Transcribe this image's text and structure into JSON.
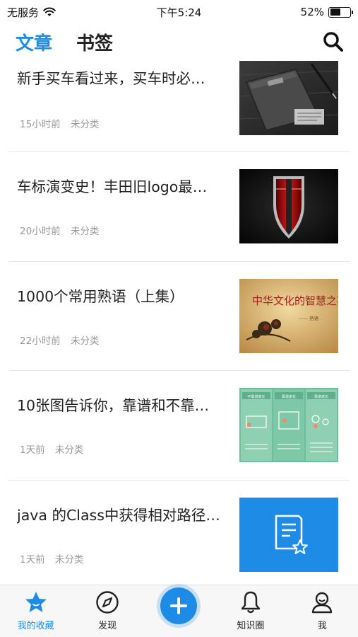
{
  "status_bar": {
    "carrier": "无服务",
    "time": "下午5:24",
    "battery_percent": "52%",
    "battery_level": 0.52
  },
  "header": {
    "tabs": [
      {
        "label": "文章",
        "active": true
      },
      {
        "label": "书签",
        "active": false
      }
    ],
    "search_icon": "search-icon"
  },
  "articles": [
    {
      "title": "新手买车看过来，买车时必…",
      "time": "15小时前",
      "category": "未分类",
      "thumb": "notebook-image"
    },
    {
      "title": "车标演变史！丰田旧logo最…",
      "time": "20小时前",
      "category": "未分类",
      "thumb": "car-logo-image"
    },
    {
      "title": "1000个常用熟语（上集）",
      "time": "22小时前",
      "category": "未分类",
      "thumb": "chinese-culture-image",
      "thumb_text": "中华文化的智慧之花",
      "thumb_sub": "—— 熟语"
    },
    {
      "title": "10张图告诉你，靠谱和不靠…",
      "time": "1天前",
      "category": "未分类",
      "thumb": "infographic-image",
      "thumb_cols": [
        "不靠谱家长",
        "靠谱家长",
        "靠谱家长"
      ]
    },
    {
      "title": "java 的Class中获得相对路径…",
      "time": "1天前",
      "category": "未分类",
      "thumb": "document-star-icon"
    }
  ],
  "bottom_nav": {
    "items": [
      {
        "label": "我的收藏",
        "icon": "star-icon",
        "active": true
      },
      {
        "label": "发现",
        "icon": "compass-icon",
        "active": false
      },
      {
        "label": "",
        "icon": "plus-icon",
        "active": false
      },
      {
        "label": "知识圈",
        "icon": "bell-icon",
        "active": false
      },
      {
        "label": "我",
        "icon": "user-icon",
        "active": false
      }
    ]
  },
  "colors": {
    "accent": "#1e8ce6",
    "text": "#222222",
    "meta": "#999999",
    "divider": "#e6e6e6"
  }
}
